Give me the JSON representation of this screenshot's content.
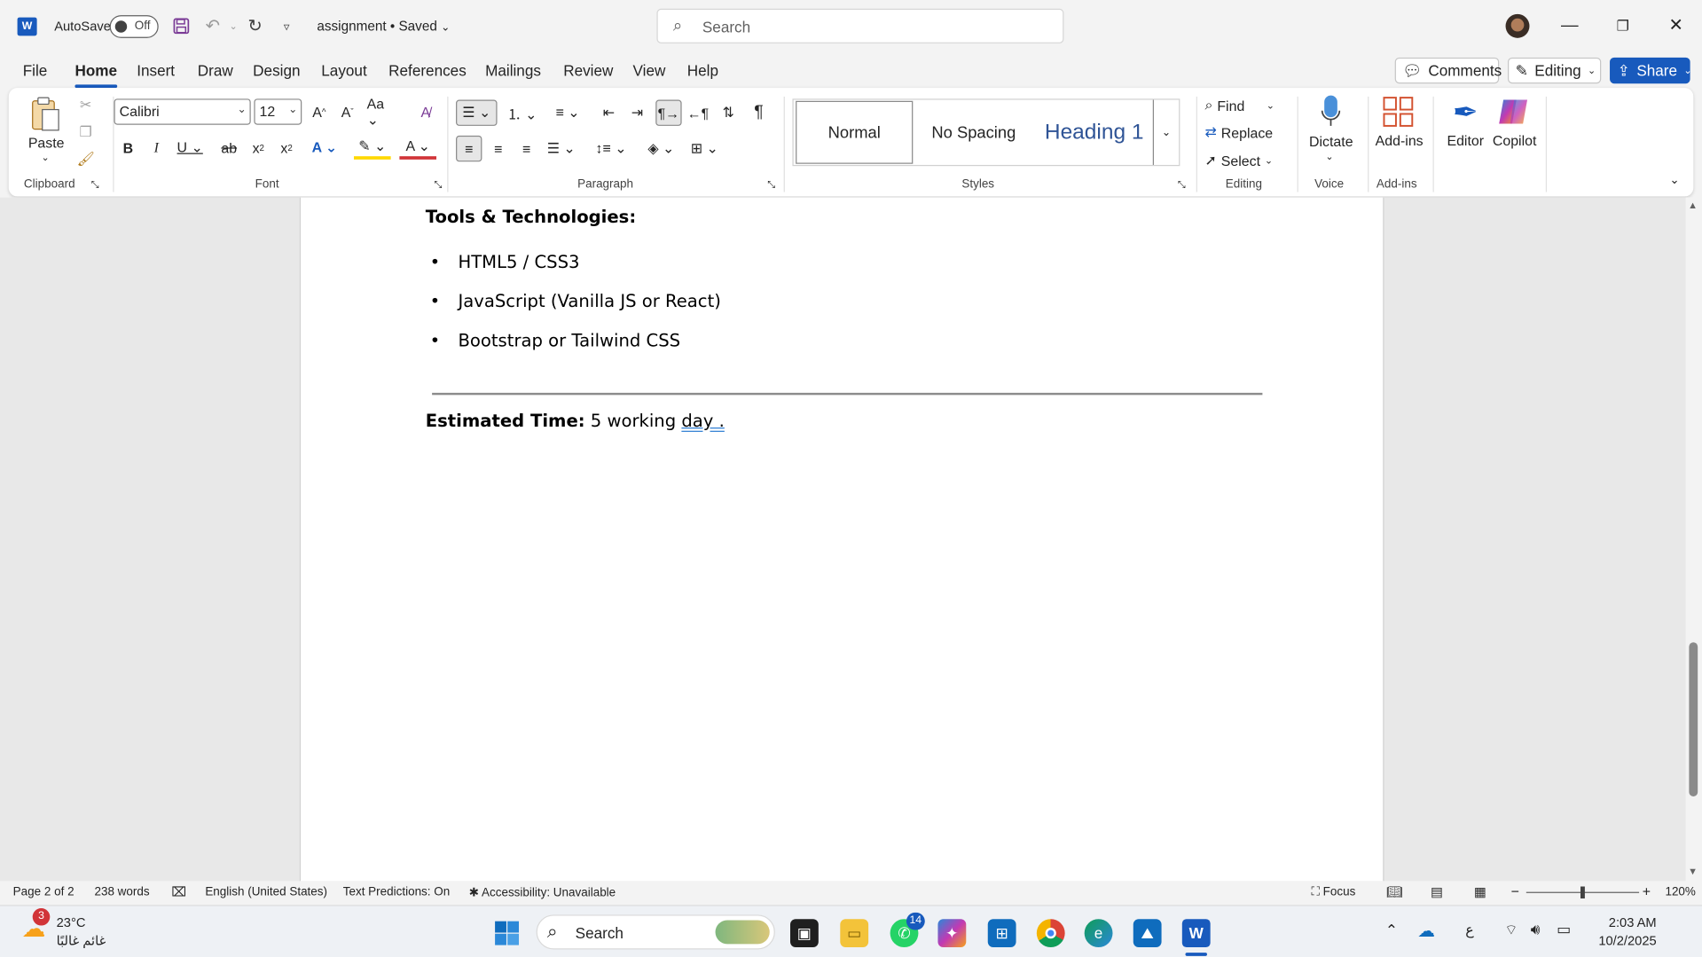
{
  "titlebar": {
    "app_letter": "W",
    "autosave_label": "AutoSave",
    "autosave_state": "Off",
    "doc_title": "assignment • Saved",
    "search_placeholder": "Search"
  },
  "tabs": [
    "File",
    "Home",
    "Insert",
    "Draw",
    "Design",
    "Layout",
    "References",
    "Mailings",
    "Review",
    "View",
    "Help"
  ],
  "active_tab": "Home",
  "header_buttons": {
    "comments": "Comments",
    "editing": "Editing",
    "share": "Share"
  },
  "ribbon": {
    "clipboard": {
      "paste": "Paste",
      "label": "Clipboard"
    },
    "font": {
      "family": "Calibri",
      "size": "12",
      "label": "Font"
    },
    "paragraph": {
      "label": "Paragraph"
    },
    "styles": {
      "items": [
        "Normal",
        "No Spacing",
        "Heading 1"
      ],
      "label": "Styles"
    },
    "editing": {
      "find": "Find",
      "replace": "Replace",
      "select": "Select",
      "label": "Editing"
    },
    "voice": {
      "dictate": "Dictate",
      "label": "Voice"
    },
    "addins": {
      "addins": "Add-ins",
      "label": "Add-ins"
    },
    "editor": "Editor",
    "copilot": "Copilot"
  },
  "document": {
    "heading": "Tools & Technologies:",
    "bullets": [
      "HTML5 / CSS3",
      "JavaScript (Vanilla JS or React)",
      "Bootstrap or Tailwind CSS"
    ],
    "estimated_label": "Estimated Time:",
    "estimated_value": " 5 working ",
    "estimated_tail": "day ."
  },
  "statusbar": {
    "page": "Page 2 of 2",
    "words": "238 words",
    "language": "English (United States)",
    "predictions": "Text Predictions: On",
    "accessibility": "Accessibility: Unavailable",
    "focus": "Focus",
    "zoom": "120%"
  },
  "taskbar": {
    "weather_temp": "23°C",
    "weather_desc": "غائم غالبًا",
    "weather_badge": "3",
    "search_placeholder": "Search",
    "whatsapp_badge": "14",
    "ime": "ع",
    "time": "2:03 AM",
    "date": "10/2/2025"
  },
  "colors": {
    "accent": "#185abd",
    "heading1": "#2f5496"
  }
}
